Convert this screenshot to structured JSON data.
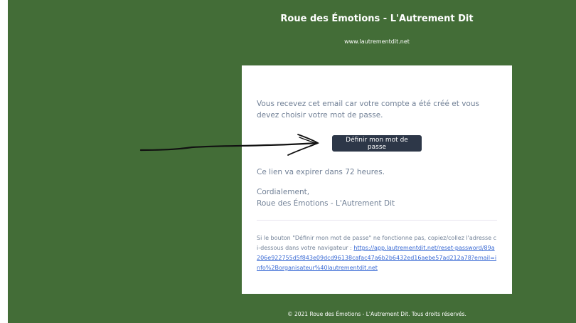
{
  "header": {
    "app_name": "Roue des Émotions - L'Autrement Dit",
    "url": "www.lautrementdit.net"
  },
  "email": {
    "intro": "Vous recevez cet email car votre compte a été créé et vous devez choisir votre mot de passe.",
    "button_label": "Définir mon mot de passe",
    "expiry": "Ce lien va expirer dans 72 heures.",
    "greeting": "Cordialement,",
    "signature": "Roue des Émotions - L'Autrement Dit",
    "subcopy_text": "Si le bouton \"Définir mon mot de passe\" ne fonctionne pas, copiez/collez l'adresse ci-dessous dans votre navigateur : ",
    "reset_link": "https://app.lautrementdit.net/reset-password/89a206e922755d5f843e09dcd96138cafac47a6b2b6432ed16aebe57ad212a78?email=info%2Borganisateur%40lautrementdit.net"
  },
  "footer": {
    "copyright": "© 2021 Roue des Émotions - L'Autrement Dit. Tous droits réservés."
  },
  "colors": {
    "background": "#436d37",
    "button": "#2d3748",
    "link": "#3869d4",
    "text": "#718096"
  }
}
